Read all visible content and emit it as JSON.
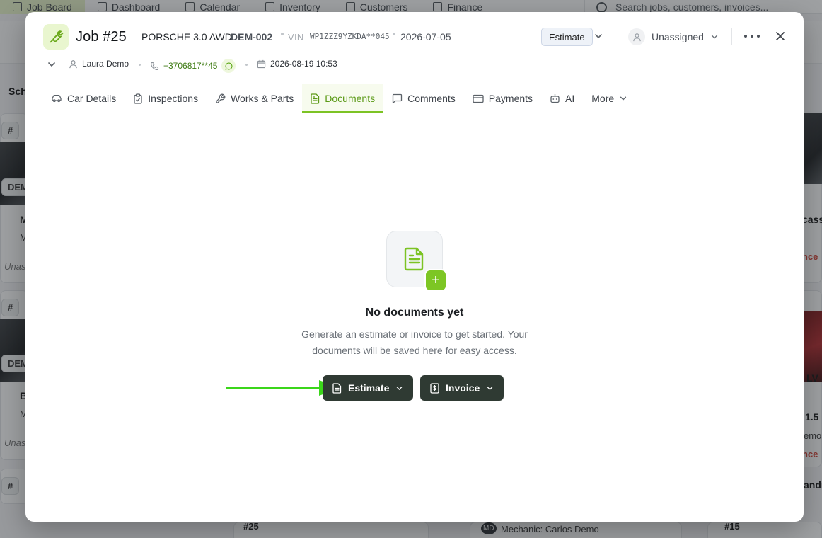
{
  "background": {
    "nav": [
      "Job Board",
      "Dashboard",
      "Calendar",
      "Inventory",
      "Customers",
      "Finance"
    ],
    "search_placeholder": "Search jobs, customers, invoices...",
    "fragments": {
      "sche": "Sche",
      "dem1": "DEM",
      "dem2": "DEM",
      "m1": "M",
      "m2": "M",
      "unas1": "Unas",
      "b": "B",
      "m3": "M",
      "unas2": "Unas",
      "hash1": "#",
      "hash2": "#",
      "hash3": "#",
      "casse": "casse",
      "ance1": "nce",
      "ance2": "nce",
      "lv": "LV",
      "one5": "1.5",
      "emo": "emo",
      "andr": "andr",
      "job25": "#25",
      "mechanic": "Mechanic: Carlos Demo",
      "md": "MD",
      "job15": "#15"
    }
  },
  "job": {
    "title": "Job #25",
    "car_model": "PORSCHE 3.0 AWD",
    "car_code": "DEM-002",
    "vin_label": "VIN",
    "vin_value": "WP1ZZZ9YZKDA**045",
    "date": "2026-07-05",
    "status": "Estimate",
    "assignee": "Unassigned",
    "customer": "Laura Demo",
    "phone": "+3706817**45",
    "appointment": "2026-08-19 10:53"
  },
  "tabs": [
    {
      "label": "Car Details",
      "icon": "car-icon"
    },
    {
      "label": "Inspections",
      "icon": "clipboard-icon"
    },
    {
      "label": "Works & Parts",
      "icon": "wrench-icon"
    },
    {
      "label": "Documents",
      "icon": "document-icon",
      "active": true
    },
    {
      "label": "Comments",
      "icon": "comment-icon"
    },
    {
      "label": "Payments",
      "icon": "card-icon"
    },
    {
      "label": "AI",
      "icon": "robot-icon"
    },
    {
      "label": "More",
      "icon": "chevron-down-icon"
    }
  ],
  "empty_state": {
    "title": "No documents yet",
    "description": "Generate an estimate or invoice to get started. Your documents will be saved here for easy access.",
    "estimate_button": "Estimate",
    "invoice_button": "Invoice"
  },
  "colors": {
    "accent": "#7cc324",
    "accent_text": "#5b9a17",
    "button_dark": "#2f3a33",
    "annotation_arrow": "#3bd61a"
  }
}
